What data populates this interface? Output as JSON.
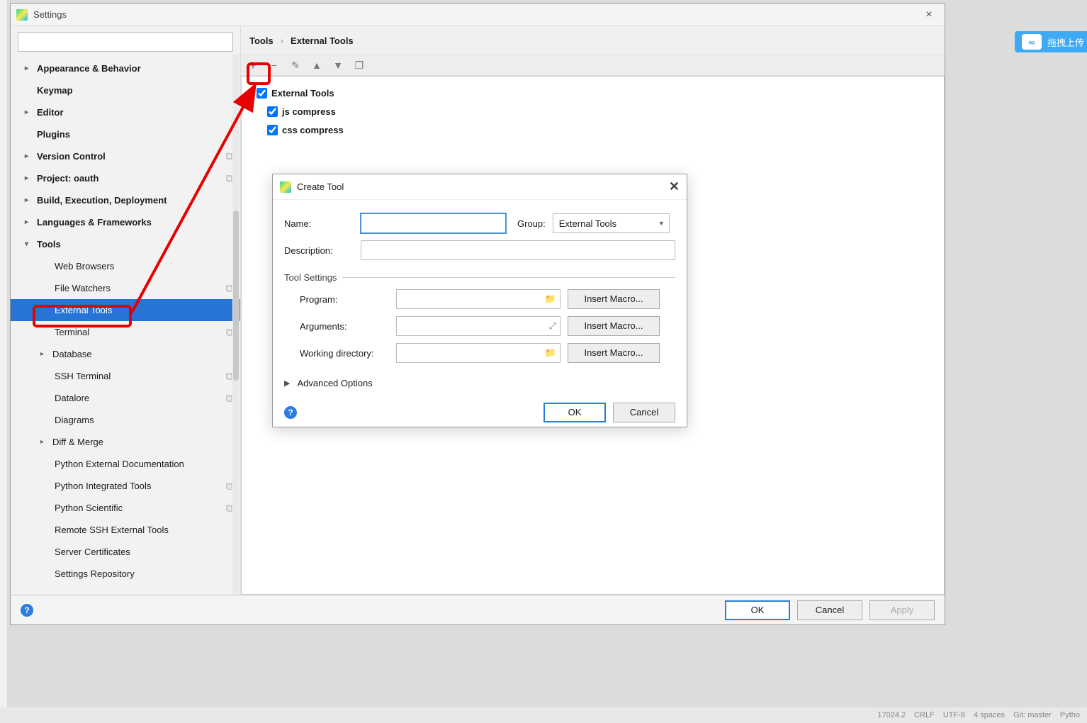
{
  "window": {
    "title": "Settings",
    "close_glyph": "×"
  },
  "search": {
    "placeholder": ""
  },
  "sidebar": {
    "items": [
      {
        "label": "Appearance & Behavior",
        "bold": true,
        "chev": "right"
      },
      {
        "label": "Keymap",
        "bold": true
      },
      {
        "label": "Editor",
        "bold": true,
        "chev": "right"
      },
      {
        "label": "Plugins",
        "bold": true
      },
      {
        "label": "Version Control",
        "bold": true,
        "chev": "right",
        "badge": true
      },
      {
        "label": "Project: oauth",
        "bold": true,
        "chev": "right",
        "badge": true
      },
      {
        "label": "Build, Execution, Deployment",
        "bold": true,
        "chev": "right"
      },
      {
        "label": "Languages & Frameworks",
        "bold": true,
        "chev": "right"
      },
      {
        "label": "Tools",
        "bold": true,
        "chev": "down"
      }
    ],
    "tools_children": [
      {
        "label": "Web Browsers"
      },
      {
        "label": "File Watchers",
        "badge": true
      },
      {
        "label": "External Tools",
        "selected": true
      },
      {
        "label": "Terminal",
        "badge": true
      },
      {
        "label": "Database",
        "chev": "right"
      },
      {
        "label": "SSH Terminal",
        "badge": true
      },
      {
        "label": "Datalore",
        "badge": true
      },
      {
        "label": "Diagrams"
      },
      {
        "label": "Diff & Merge",
        "chev": "right"
      },
      {
        "label": "Python External Documentation"
      },
      {
        "label": "Python Integrated Tools",
        "badge": true
      },
      {
        "label": "Python Scientific",
        "badge": true
      },
      {
        "label": "Remote SSH External Tools"
      },
      {
        "label": "Server Certificates"
      },
      {
        "label": "Settings Repository"
      }
    ]
  },
  "breadcrumb": {
    "root": "Tools",
    "sep": "›",
    "leaf": "External Tools"
  },
  "toolbar": {
    "icons": {
      "add": "+",
      "remove": "−",
      "edit": "✎",
      "up": "▲",
      "down": "▼",
      "copy": "❐"
    }
  },
  "ext_tree": {
    "group": "External Tools",
    "children": [
      "js compress",
      "css compress"
    ]
  },
  "dialog": {
    "title": "Create Tool",
    "close_glyph": "✕",
    "name_lbl": "Name:",
    "group_lbl": "Group:",
    "group_value": "External Tools",
    "desc_lbl": "Description:",
    "section_tool": "Tool Settings",
    "program_lbl": "Program:",
    "args_lbl": "Arguments:",
    "wd_lbl": "Working directory:",
    "macro_btn": "Insert Macro...",
    "adv_lbl": "Advanced Options",
    "ok": "OK",
    "cancel": "Cancel"
  },
  "footer": {
    "ok": "OK",
    "cancel": "Cancel",
    "apply": "Apply"
  },
  "right_badge": {
    "text": "拖拽上传",
    "glyph": "∞"
  },
  "statusbar": {
    "items": [
      "17024.2",
      "CRLF",
      "UTF-8",
      "4 spaces",
      "Git: master",
      "Pytho"
    ]
  }
}
